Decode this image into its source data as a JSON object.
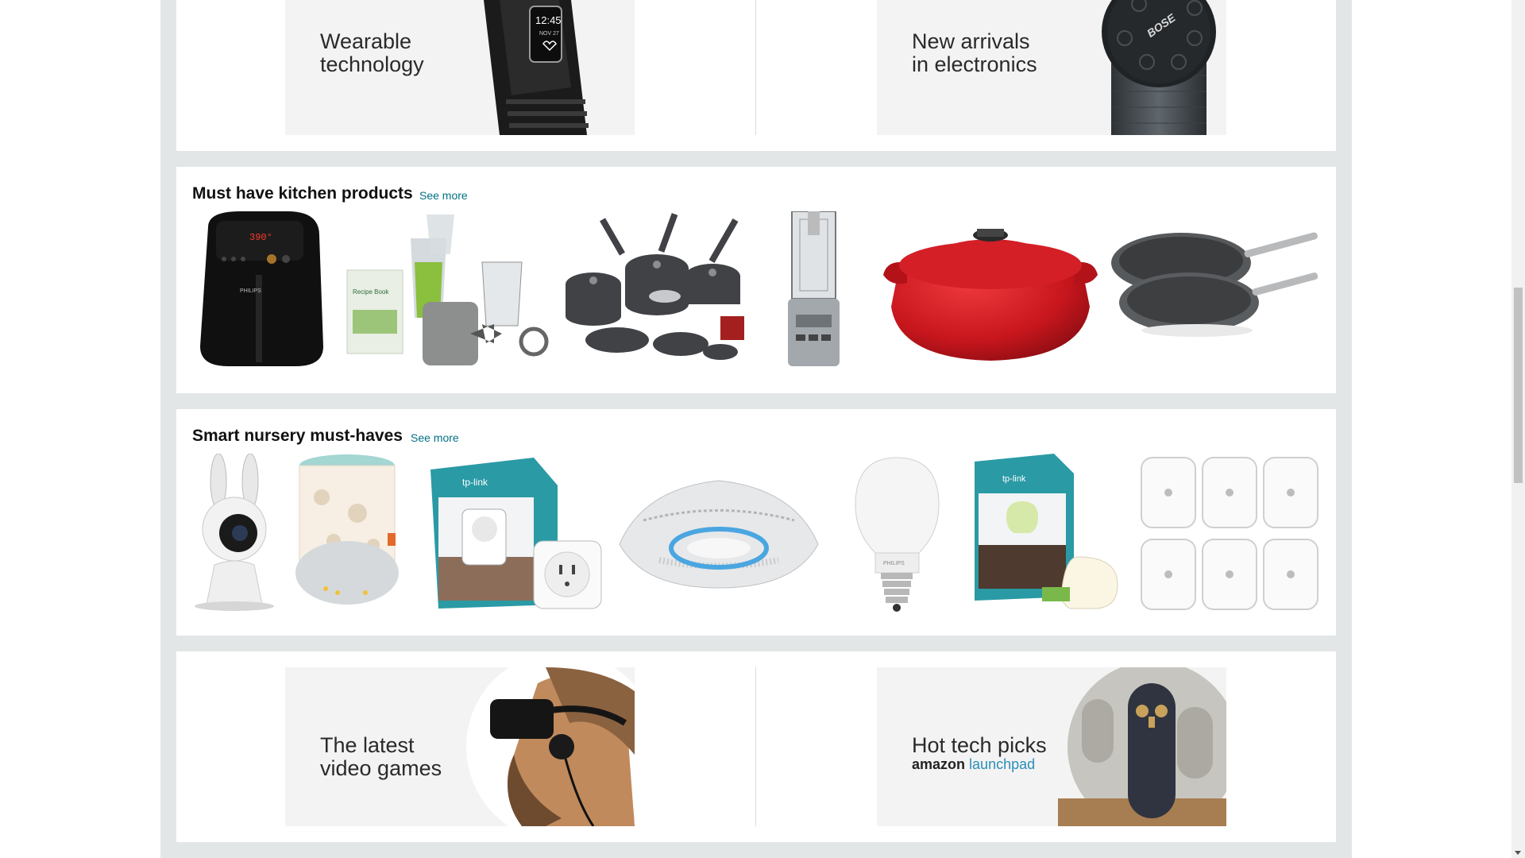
{
  "banners_top": {
    "left": {
      "line1": "Wearable",
      "line2": "technology",
      "icon": "fitness-tracker"
    },
    "right": {
      "line1": "New arrivals",
      "line2": "in electronics",
      "icon": "bluetooth-speaker"
    }
  },
  "kitchen": {
    "heading": "Must have kitchen products",
    "see_more": "See more",
    "items": [
      "air-fryer",
      "blender-set",
      "cookware-set",
      "food-processor",
      "dutch-oven",
      "frying-pans"
    ]
  },
  "nursery": {
    "heading": "Smart nursery must-haves",
    "see_more": "See more",
    "items": [
      "bunny-baby-camera",
      "night-light-projector",
      "smart-plug",
      "smoke-detector",
      "smart-bulb",
      "smart-led-bulb-box",
      "plug-in-night-lights"
    ]
  },
  "banners_bottom": {
    "left": {
      "line1": "The latest",
      "line2": "video games",
      "icon": "vr-headset"
    },
    "right": {
      "line1": "Hot tech picks",
      "brand_a": "amazon",
      "brand_b": "launchpad",
      "icon": "conference-camera"
    }
  },
  "colors": {
    "link": "#007185",
    "gutter": "#e3e6e6",
    "dutch_oven": "#c8161d"
  }
}
